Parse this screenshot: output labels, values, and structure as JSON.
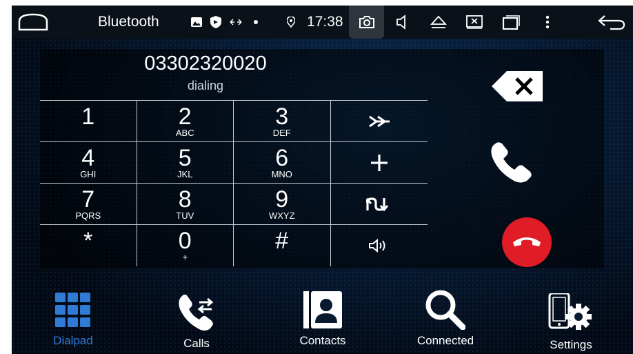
{
  "status_bar": {
    "app_name": "Bluetooth",
    "time": "17:38",
    "icons": [
      "home-icon",
      "image-icon",
      "shield-icon",
      "sync-arrows-icon",
      "dot-icon",
      "location-icon",
      "camera-icon",
      "volume-icon",
      "eject-icon",
      "screenshot-icon",
      "recent-apps-icon",
      "more-vert-icon",
      "back-icon"
    ]
  },
  "call": {
    "number": "03302320020",
    "status": "dialing"
  },
  "keypad": {
    "keys": [
      {
        "digit": "1",
        "letters": ""
      },
      {
        "digit": "2",
        "letters": "ABC"
      },
      {
        "digit": "3",
        "letters": "DEF"
      },
      {
        "digit": "4",
        "letters": "GHI"
      },
      {
        "digit": "5",
        "letters": "JKL"
      },
      {
        "digit": "6",
        "letters": "MNO"
      },
      {
        "digit": "7",
        "letters": "PQRS"
      },
      {
        "digit": "8",
        "letters": "TUV"
      },
      {
        "digit": "9",
        "letters": "WXYZ"
      },
      {
        "digit": "*",
        "letters": ""
      },
      {
        "digit": "0",
        "letters": "+"
      },
      {
        "digit": "#",
        "letters": ""
      }
    ],
    "side_keys": [
      "skip-forward-icon",
      "plus-icon",
      "transfer-icon",
      "speaker-icon"
    ]
  },
  "actions": {
    "backspace": "backspace-icon",
    "call": "phone-icon",
    "hangup": "hangup-icon",
    "hangup_color": "#e01c27"
  },
  "nav": {
    "items": [
      {
        "label": "Dialpad",
        "icon": "grid-icon",
        "active": true,
        "color": "#2f7bd6"
      },
      {
        "label": "Calls",
        "icon": "call-log-icon",
        "active": false
      },
      {
        "label": "Contacts",
        "icon": "contacts-icon",
        "active": false
      },
      {
        "label": "Connected",
        "icon": "search-icon",
        "active": false
      },
      {
        "label": "Settings",
        "icon": "phone-settings-icon",
        "active": false
      }
    ]
  }
}
